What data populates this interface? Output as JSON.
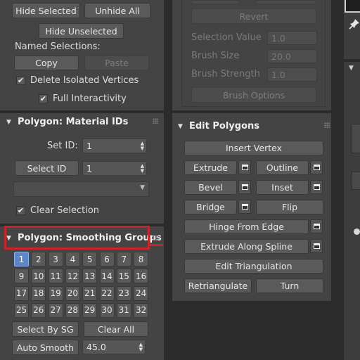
{
  "selection": {
    "hide_selected": "Hide Selected",
    "unhide_all": "Unhide All",
    "hide_unselected": "Hide Unselected",
    "named_selections_label": "Named Selections:",
    "copy": "Copy",
    "paste": "Paste",
    "delete_isolated_vertices": "Delete Isolated Vertices",
    "delete_isolated_checked": true,
    "full_interactivity": "Full Interactivity",
    "full_interactivity_checked": true
  },
  "soft_selection": {
    "revert": "Revert",
    "selection_value_label": "Selection Value",
    "selection_value": "1.0",
    "brush_size_label": "Brush Size",
    "brush_size": "20.0",
    "brush_strength_label": "Brush Strength",
    "brush_strength": "1.0",
    "brush_options": "Brush Options"
  },
  "material_ids": {
    "title": "Polygon: Material IDs",
    "set_id_label": "Set ID:",
    "set_id_value": "1",
    "select_id_button": "Select ID",
    "select_id_value": "1",
    "dropdown_value": "",
    "clear_selection": "Clear Selection",
    "clear_selection_checked": true
  },
  "smoothing_groups": {
    "title": "Polygon: Smoothing Groups",
    "groups": [
      "1",
      "2",
      "3",
      "4",
      "5",
      "6",
      "7",
      "8",
      "9",
      "10",
      "11",
      "12",
      "13",
      "14",
      "15",
      "16",
      "17",
      "18",
      "19",
      "20",
      "21",
      "22",
      "23",
      "24",
      "25",
      "26",
      "27",
      "28",
      "29",
      "30",
      "31",
      "32"
    ],
    "active_group": "1",
    "select_by_sg": "Select By SG",
    "clear_all": "Clear All",
    "auto_smooth": "Auto Smooth",
    "auto_smooth_value": "45.0"
  },
  "edit_polygons": {
    "title": "Edit Polygons",
    "insert_vertex": "Insert Vertex",
    "extrude": "Extrude",
    "outline": "Outline",
    "bevel": "Bevel",
    "inset": "Inset",
    "bridge": "Bridge",
    "flip": "Flip",
    "hinge_from_edge": "Hinge From Edge",
    "extrude_along_spline": "Extrude Along Spline",
    "edit_triangulation": "Edit Triangulation",
    "retriangulate": "Retriangulate",
    "turn": "Turn"
  },
  "icons": {
    "pin": "pin-icon",
    "settings_box": "settings-box-icon",
    "rollout_arrow": "collapse-arrow-icon",
    "grip": "grip-dots-icon"
  },
  "colors": {
    "background": "#444444",
    "highlight": "#c8242a",
    "active_group": "#5b87c8"
  }
}
